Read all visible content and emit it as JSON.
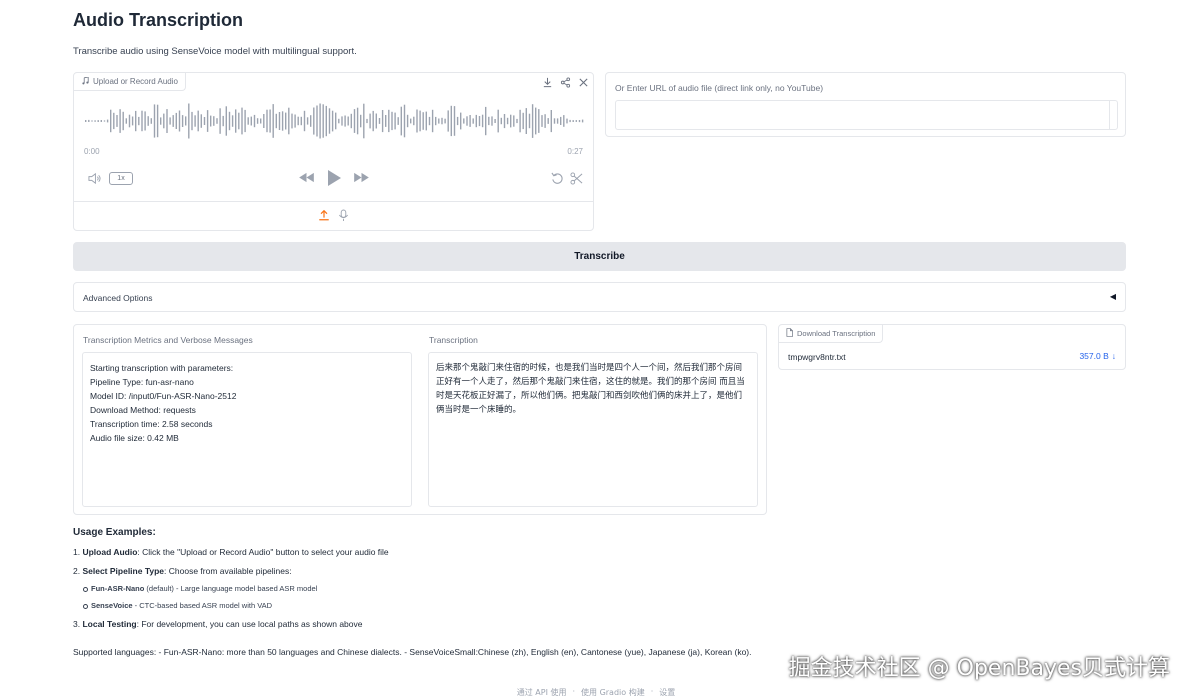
{
  "page": {
    "title": "Audio Transcription",
    "description": "Transcribe audio using SenseVoice model with multilingual support."
  },
  "audio": {
    "label": "Upload or Record Audio",
    "time_start": "0:00",
    "time_end": "0:27",
    "speed": "1x"
  },
  "url_input": {
    "label": "Or Enter URL of audio file (direct link only, no YouTube)",
    "value": ""
  },
  "transcribe_button": "Transcribe",
  "advanced": {
    "label": "Advanced Options",
    "toggle": "◀"
  },
  "metrics": {
    "label": "Transcription Metrics and Verbose Messages",
    "lines": [
      "Starting transcription with parameters:",
      "Pipeline Type: fun-asr-nano",
      "Model ID: /input0/Fun-ASR-Nano-2512",
      "Download Method: requests",
      "Transcription time: 2.58 seconds",
      "Audio file size: 0.42 MB"
    ]
  },
  "transcription": {
    "label": "Transcription",
    "text": "后来那个鬼敲门来住宿的时候，也是我们当时是四个人一个间，然后我们那个房间正好有一个人走了，然后那个鬼敲门来住宿，这住的就是。我们的那个房间 而且当时是天花板正好漏了，所以他们俩。把鬼敲门和西剑吹他们俩的床并上了，是他们俩当时是一个床睡的。"
  },
  "download": {
    "label": "Download Transcription",
    "file_name": "tmpwgrv8ntr.txt",
    "file_size": "357.0 B",
    "download_arrow": "↓"
  },
  "usage": {
    "title": "Usage Examples:",
    "step1_num": "1.",
    "step1_bold": "Upload Audio",
    "step1_text": ": Click the \"Upload or Record Audio\" button to select your audio file",
    "step2_num": "2.",
    "step2_bold": "Select Pipeline Type",
    "step2_text": ": Choose from available pipelines:",
    "sub1_bold": "Fun-ASR-Nano",
    "sub1_text": " (default) - Large language model based ASR model",
    "sub2_bold": "SenseVoice",
    "sub2_text": " - CTC-based based ASR model with VAD",
    "step3_num": "3.",
    "step3_bold": "Local Testing",
    "step3_text": ": For development, you can use local paths as shown above"
  },
  "supported": "Supported languages: - Fun-ASR-Nano: more than 50 languages and Chinese dialects. - SenseVoiceSmall:Chinese (zh), English (en), Cantonese (yue), Japanese (ja), Korean (ko).",
  "footer": {
    "api": "通过 API 使用",
    "sep1": "·",
    "gradio": "使用 Gradio 构建",
    "sep2": "·",
    "settings": "设置"
  },
  "watermark": "掘金技术社区 @ OpenBayes贝式计算",
  "colors": {
    "accent_orange": "#f97316",
    "link_blue": "#2563eb",
    "button_gray": "#e5e7eb",
    "border": "#e5e7eb"
  }
}
